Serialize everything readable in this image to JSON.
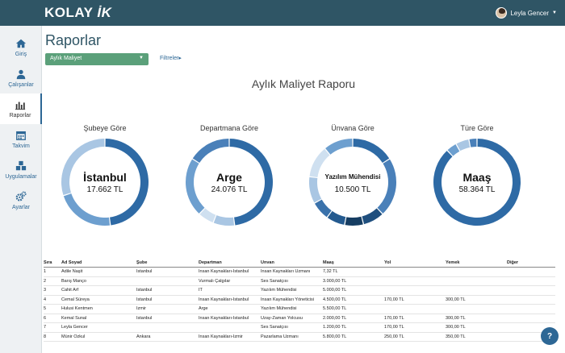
{
  "header": {
    "logo": "KOLAY",
    "logo_ik": "İK",
    "user_name": "Leyla Gencer"
  },
  "sidebar": {
    "items": [
      {
        "label": "Giriş",
        "icon": "home-icon"
      },
      {
        "label": "Çalışanlar",
        "icon": "users-icon"
      },
      {
        "label": "Raporlar",
        "icon": "bar-chart-icon",
        "active": true
      },
      {
        "label": "Takvim",
        "icon": "calendar-icon"
      },
      {
        "label": "Uygulamalar",
        "icon": "cubes-icon"
      },
      {
        "label": "Ayarlar",
        "icon": "gears-icon"
      }
    ]
  },
  "main": {
    "title": "Raporlar",
    "report_select": "Aylık Maliyet",
    "filters": "Filtreler",
    "report_title": "Aylık Maliyet Raporu"
  },
  "colors": {
    "topbar": "#2f5565",
    "accent": "#2d6795",
    "select": "#5ba07a"
  },
  "chart_data": [
    {
      "type": "pie",
      "title": "Şubeye Göre",
      "center_label": "İstanbul",
      "center_value": "17.662 TL",
      "slices": [
        0.48,
        0.22,
        0.3
      ],
      "colors": [
        "#2e6aa5",
        "#6d9fcf",
        "#a9c6e3"
      ]
    },
    {
      "type": "pie",
      "title": "Departmana Göre",
      "center_label": "Arge",
      "center_value": "24.076 TL",
      "slices": [
        0.48,
        0.08,
        0.06,
        0.22,
        0.16
      ],
      "colors": [
        "#2e6aa5",
        "#a9c6e3",
        "#cfe0f0",
        "#6d9fcf",
        "#4a80b9"
      ]
    },
    {
      "type": "pie",
      "title": "Ünvana Göre",
      "center_label": "Yazılım Mühendisi",
      "center_value": "10.500 TL",
      "slices": [
        0.16,
        0.22,
        0.08,
        0.07,
        0.07,
        0.07,
        0.1,
        0.12,
        0.11
      ],
      "colors": [
        "#2e6aa5",
        "#4a80b9",
        "#1f4f7e",
        "#163d62",
        "#245a8f",
        "#3a72ab",
        "#a9c6e3",
        "#cfe0f0",
        "#6d9fcf"
      ]
    },
    {
      "type": "pie",
      "title": "Türe Göre",
      "center_label": "Maaş",
      "center_value": "58.364 TL",
      "slices": [
        0.88,
        0.04,
        0.05,
        0.03
      ],
      "colors": [
        "#2e6aa5",
        "#6d9fcf",
        "#a9c6e3",
        "#4a80b9"
      ]
    }
  ],
  "table": {
    "headers": [
      "Sıra",
      "Ad Soyad",
      "Şube",
      "Departman",
      "Ünvan",
      "Maaş",
      "Yol",
      "Yemek",
      "Diğer"
    ],
    "rows": [
      [
        "1",
        "Adile Naşit",
        "İstanbul",
        "İnsan Kaynakları-İstanbul",
        "İnsan Kaynakları Uzmanı",
        "7,32 TL",
        "",
        "",
        ""
      ],
      [
        "2",
        "Barış Manço",
        "",
        "Vurmalı Çalgılar",
        "Ses Sanatçısı",
        "3.000,00 TL",
        "",
        "",
        ""
      ],
      [
        "3",
        "Cahit Arf",
        "İstanbul",
        "IT",
        "Yazılım Mühendisi",
        "5.000,00 TL",
        "",
        "",
        ""
      ],
      [
        "4",
        "Cemal Süreya",
        "İstanbul",
        "İnsan Kaynakları-İstanbul",
        "İnsan Kaynakları Yöneticisi",
        "4.500,00 TL",
        "170,00 TL",
        "300,00 TL",
        ""
      ],
      [
        "5",
        "Hulusi Kentmen",
        "İzmir",
        "Arge",
        "Yazılım Mühendisi",
        "5.500,00 TL",
        "",
        "",
        ""
      ],
      [
        "6",
        "Kemal Sunal",
        "İstanbul",
        "İnsan Kaynakları-İstanbul",
        "Uzay-Zaman Yolcusu",
        "2.000,00 TL",
        "170,00 TL",
        "300,00 TL",
        ""
      ],
      [
        "7",
        "Leyla Gencer",
        "",
        "",
        "Ses Sanatçısı",
        "1.200,00 TL",
        "170,00 TL",
        "300,00 TL",
        ""
      ],
      [
        "8",
        "Münir Özkul",
        "Ankara",
        "İnsan Kaynakları-İzmir",
        "Pazarlama Uzmanı",
        "5.800,00 TL",
        "250,00 TL",
        "350,00 TL",
        ""
      ]
    ]
  },
  "help": {
    "label": "?"
  }
}
